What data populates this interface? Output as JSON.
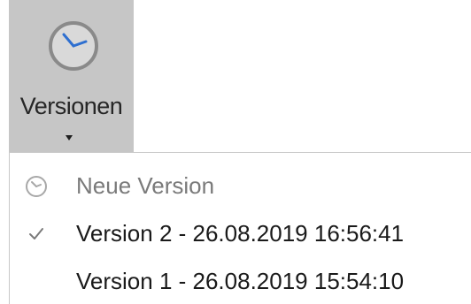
{
  "ribbon": {
    "versions_label": "Versionen",
    "icon": "clock-icon"
  },
  "menu": {
    "items": [
      {
        "label": "Neue Version",
        "icon": "clock-icon",
        "state": "disabled"
      },
      {
        "label": "Version 2 - 26.08.2019 16:56:41",
        "icon": "checkmark-icon",
        "state": "checked"
      },
      {
        "label": "Version 1 - 26.08.2019 15:54:10",
        "icon": "",
        "state": "normal"
      }
    ]
  },
  "colors": {
    "ribbon_background": "#c6c6c6",
    "clock_face_border": "#8a8a8a",
    "clock_hands": "#2e6fd0",
    "disabled_text": "#7a7a7a",
    "menu_text": "#1a1a1a"
  }
}
